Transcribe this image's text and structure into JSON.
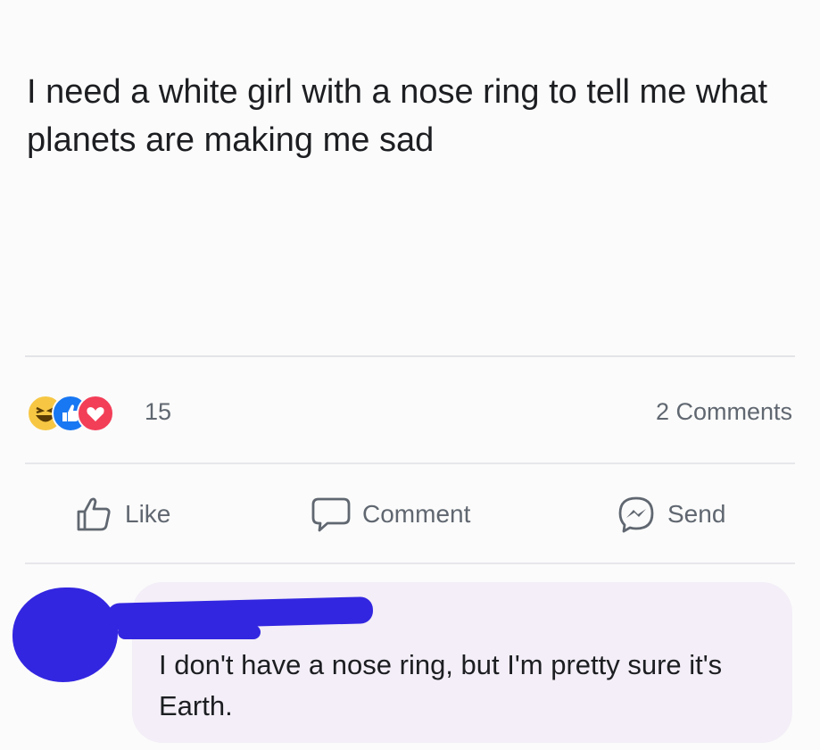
{
  "post": {
    "text": "I need a white girl with a nose ring to tell me what planets are making me sad"
  },
  "stats": {
    "reactions": [
      "haha-icon",
      "like-icon",
      "love-icon"
    ],
    "reaction_count": "15",
    "comments_label": "2 Comments"
  },
  "actions": {
    "like_label": "Like",
    "comment_label": "Comment",
    "send_label": "Send"
  },
  "comment": {
    "text": "I don't have a nose ring, but I'm pretty sure it's Earth."
  },
  "colors": {
    "like_blue": "#1877f2",
    "love_red": "#f33e58",
    "haha_yellow": "#f7c744",
    "scribble_blue": "#3326e0",
    "bubble_bg": "#f3eef7"
  }
}
